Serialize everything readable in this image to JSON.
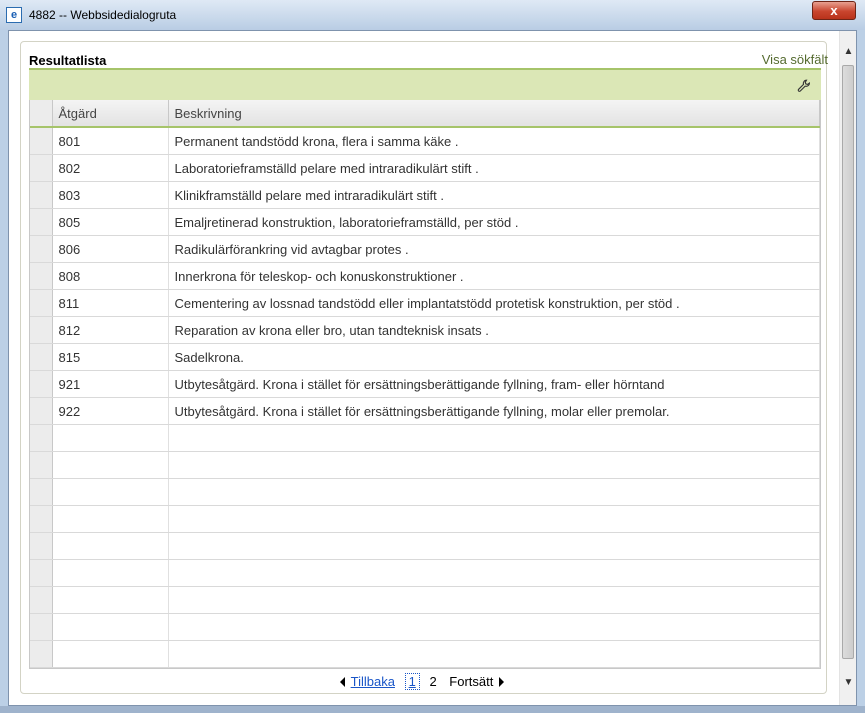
{
  "window": {
    "title": "4882 -- Webbsidedialogruta",
    "close_label": "x"
  },
  "panel": {
    "title": "Resultatlista",
    "search_link": "Visa sökfält"
  },
  "table": {
    "columns": [
      "Åtgärd",
      "Beskrivning"
    ],
    "rows": [
      {
        "code": "801",
        "desc": "Permanent tandstödd krona, flera i samma käke                     ."
      },
      {
        "code": "802",
        "desc": "Laboratorieframställd pelare med intraradikulärt stift                     ."
      },
      {
        "code": "803",
        "desc": "Klinikframställd pelare med intraradikulärt stift                     ."
      },
      {
        "code": "805",
        "desc": "Emaljretinerad konstruktion, laboratorieframställd, per stöd                     ."
      },
      {
        "code": "806",
        "desc": "Radikulärförankring vid avtagbar protes                     ."
      },
      {
        "code": "808",
        "desc": "Innerkrona för teleskop- och konuskonstruktioner                     ."
      },
      {
        "code": "811",
        "desc": "Cementering av lossnad tandstödd eller implantatstödd protetisk konstruktion, per stöd                     ."
      },
      {
        "code": "812",
        "desc": "Reparation av krona eller bro, utan tandteknisk insats                     ."
      },
      {
        "code": "815",
        "desc": "Sadelkrona."
      },
      {
        "code": "921",
        "desc": "Utbytesåtgärd. Krona i stället för ersättningsberättigande fyllning, fram- eller hörntand"
      },
      {
        "code": "922",
        "desc": "Utbytesåtgärd. Krona i stället för ersättningsberättigande fyllning, molar eller premolar."
      }
    ]
  },
  "pager": {
    "back_label": "Tillbaka",
    "pages": [
      "1",
      "2"
    ],
    "current_page": "1",
    "next_label": "Fortsätt"
  }
}
